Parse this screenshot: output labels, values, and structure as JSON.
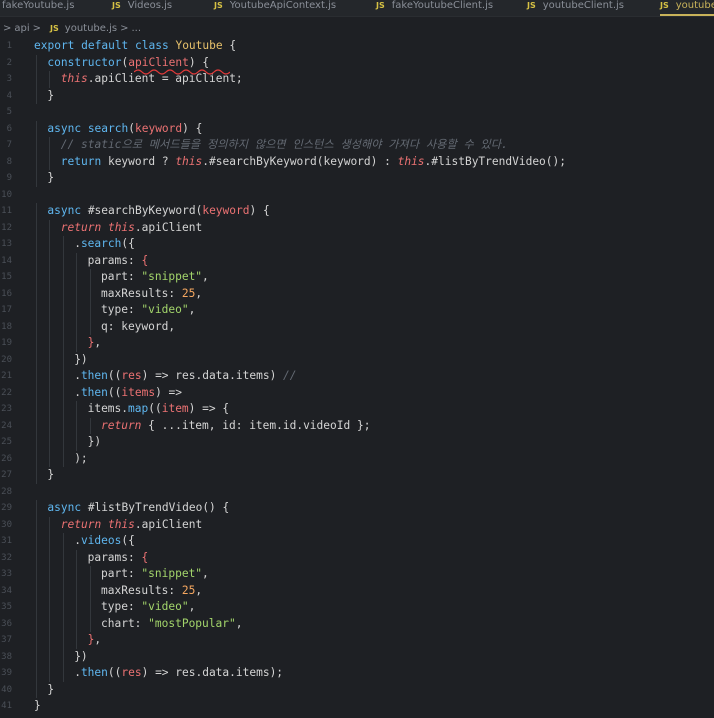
{
  "tabs": [
    {
      "icon": "",
      "label": "fakeYoutube.js",
      "active": false
    },
    {
      "icon": "JS",
      "label": "Videos.js",
      "active": false
    },
    {
      "icon": "JS",
      "label": "YoutubeApiContext.js",
      "active": false
    },
    {
      "icon": "JS",
      "label": "fakeYoutubeClient.js",
      "active": false
    },
    {
      "icon": "JS",
      "label": "youtubeClient.js",
      "active": false
    },
    {
      "icon": "JS",
      "label": "youtube",
      "active": true
    }
  ],
  "breadcrumb": {
    "folder": "api",
    "sep1": ">",
    "icon": "JS",
    "file": "youtube.js",
    "sep2": ">",
    "more": "..."
  },
  "code_lines": [
    {
      "n": "1",
      "indent": 0,
      "t": [
        [
          "k",
          "export default class "
        ],
        [
          "cls",
          "Youtube"
        ],
        [
          "pl",
          " {"
        ]
      ]
    },
    {
      "n": "2",
      "indent": 1,
      "t": [
        [
          "fn",
          "constructor"
        ],
        [
          "pl",
          "("
        ],
        [
          "p",
          "apiClient"
        ],
        [
          "pl",
          ") {"
        ]
      ]
    },
    {
      "n": "3",
      "indent": 2,
      "t": [
        [
          "k2",
          "this"
        ],
        [
          "pl",
          ".apiClient = apiClient;"
        ]
      ]
    },
    {
      "n": "4",
      "indent": 1,
      "t": [
        [
          "pl",
          "}"
        ]
      ]
    },
    {
      "n": "5",
      "indent": 0,
      "t": []
    },
    {
      "n": "6",
      "indent": 1,
      "t": [
        [
          "k",
          "async "
        ],
        [
          "fn",
          "search"
        ],
        [
          "pl",
          "("
        ],
        [
          "p",
          "keyword"
        ],
        [
          "pl",
          ") {"
        ]
      ]
    },
    {
      "n": "7",
      "indent": 2,
      "t": [
        [
          "c",
          "// static으로 메서드들을 정의하지 않으면 인스턴스 생성해야 가져다 사용할 수 있다."
        ]
      ]
    },
    {
      "n": "8",
      "indent": 2,
      "t": [
        [
          "k",
          "return "
        ],
        [
          "pl",
          "keyword ? "
        ],
        [
          "k2",
          "this"
        ],
        [
          "pl",
          ".#searchByKeyword(keyword) : "
        ],
        [
          "k2",
          "this"
        ],
        [
          "pl",
          ".#listByTrendVideo();"
        ]
      ]
    },
    {
      "n": "9",
      "indent": 1,
      "t": [
        [
          "pl",
          "}"
        ]
      ]
    },
    {
      "n": "10",
      "indent": 0,
      "t": []
    },
    {
      "n": "11",
      "indent": 1,
      "t": [
        [
          "k",
          "async "
        ],
        [
          "pl",
          "#searchByKeyword("
        ],
        [
          "p",
          "keyword"
        ],
        [
          "pl",
          ") {"
        ]
      ]
    },
    {
      "n": "12",
      "indent": 2,
      "t": [
        [
          "k2",
          "return "
        ],
        [
          "k2",
          "this"
        ],
        [
          "pl",
          ".apiClient"
        ]
      ]
    },
    {
      "n": "13",
      "indent": 3,
      "t": [
        [
          "pl",
          "."
        ],
        [
          "fn",
          "search"
        ],
        [
          "pl",
          "({"
        ]
      ]
    },
    {
      "n": "14",
      "indent": 4,
      "t": [
        [
          "pl",
          "params: "
        ],
        [
          "p",
          "{"
        ]
      ]
    },
    {
      "n": "15",
      "indent": 5,
      "t": [
        [
          "pl",
          "part: "
        ],
        [
          "s",
          "\"snippet\""
        ],
        [
          "pl",
          ","
        ]
      ]
    },
    {
      "n": "16",
      "indent": 5,
      "t": [
        [
          "pl",
          "maxResults: "
        ],
        [
          "n",
          "25"
        ],
        [
          "pl",
          ","
        ]
      ]
    },
    {
      "n": "17",
      "indent": 5,
      "t": [
        [
          "pl",
          "type: "
        ],
        [
          "s",
          "\"video\""
        ],
        [
          "pl",
          ","
        ]
      ]
    },
    {
      "n": "18",
      "indent": 5,
      "t": [
        [
          "pl",
          "q: keyword,"
        ]
      ]
    },
    {
      "n": "19",
      "indent": 4,
      "t": [
        [
          "p",
          "}"
        ],
        [
          "pl",
          ","
        ]
      ]
    },
    {
      "n": "20",
      "indent": 3,
      "t": [
        [
          "pl",
          "})"
        ]
      ]
    },
    {
      "n": "21",
      "indent": 3,
      "t": [
        [
          "pl",
          "."
        ],
        [
          "fn",
          "then"
        ],
        [
          "pl",
          "(("
        ],
        [
          "p",
          "res"
        ],
        [
          "pl",
          ") => res.data.items) "
        ],
        [
          "c",
          "//"
        ]
      ]
    },
    {
      "n": "22",
      "indent": 3,
      "t": [
        [
          "pl",
          "."
        ],
        [
          "fn",
          "then"
        ],
        [
          "pl",
          "(("
        ],
        [
          "p",
          "items"
        ],
        [
          "pl",
          ") =>"
        ]
      ]
    },
    {
      "n": "23",
      "indent": 4,
      "t": [
        [
          "pl",
          "items."
        ],
        [
          "fn",
          "map"
        ],
        [
          "pl",
          "(("
        ],
        [
          "p",
          "item"
        ],
        [
          "pl",
          ") => {"
        ]
      ]
    },
    {
      "n": "24",
      "indent": 5,
      "t": [
        [
          "k2",
          "return "
        ],
        [
          "pl",
          "{ ...item, id: item.id.videoId };"
        ]
      ]
    },
    {
      "n": "25",
      "indent": 4,
      "t": [
        [
          "pl",
          "})"
        ]
      ]
    },
    {
      "n": "26",
      "indent": 3,
      "t": [
        [
          "pl",
          ");"
        ]
      ]
    },
    {
      "n": "27",
      "indent": 1,
      "t": [
        [
          "pl",
          "}"
        ]
      ]
    },
    {
      "n": "28",
      "indent": 0,
      "t": []
    },
    {
      "n": "29",
      "indent": 1,
      "t": [
        [
          "k",
          "async "
        ],
        [
          "pl",
          "#listByTrendVideo() {"
        ]
      ]
    },
    {
      "n": "30",
      "indent": 2,
      "t": [
        [
          "k2",
          "return "
        ],
        [
          "k2",
          "this"
        ],
        [
          "pl",
          ".apiClient"
        ]
      ]
    },
    {
      "n": "31",
      "indent": 3,
      "t": [
        [
          "pl",
          "."
        ],
        [
          "fn",
          "videos"
        ],
        [
          "pl",
          "({"
        ]
      ]
    },
    {
      "n": "32",
      "indent": 4,
      "t": [
        [
          "pl",
          "params: "
        ],
        [
          "p",
          "{"
        ]
      ]
    },
    {
      "n": "33",
      "indent": 5,
      "t": [
        [
          "pl",
          "part: "
        ],
        [
          "s",
          "\"snippet\""
        ],
        [
          "pl",
          ","
        ]
      ]
    },
    {
      "n": "34",
      "indent": 5,
      "t": [
        [
          "pl",
          "maxResults: "
        ],
        [
          "n",
          "25"
        ],
        [
          "pl",
          ","
        ]
      ]
    },
    {
      "n": "35",
      "indent": 5,
      "t": [
        [
          "pl",
          "type: "
        ],
        [
          "s",
          "\"video\""
        ],
        [
          "pl",
          ","
        ]
      ]
    },
    {
      "n": "36",
      "indent": 5,
      "t": [
        [
          "pl",
          "chart: "
        ],
        [
          "s",
          "\"mostPopular\""
        ],
        [
          "pl",
          ","
        ]
      ]
    },
    {
      "n": "37",
      "indent": 4,
      "t": [
        [
          "p",
          "}"
        ],
        [
          "pl",
          ","
        ]
      ]
    },
    {
      "n": "38",
      "indent": 3,
      "t": [
        [
          "pl",
          "})"
        ]
      ]
    },
    {
      "n": "39",
      "indent": 3,
      "t": [
        [
          "pl",
          "."
        ],
        [
          "fn",
          "then"
        ],
        [
          "pl",
          "(("
        ],
        [
          "p",
          "res"
        ],
        [
          "pl",
          ") => res.data.items);"
        ]
      ]
    },
    {
      "n": "40",
      "indent": 1,
      "t": [
        [
          "pl",
          "}"
        ]
      ]
    },
    {
      "n": "41",
      "indent": 0,
      "t": [
        [
          "pl",
          "}"
        ]
      ]
    }
  ]
}
